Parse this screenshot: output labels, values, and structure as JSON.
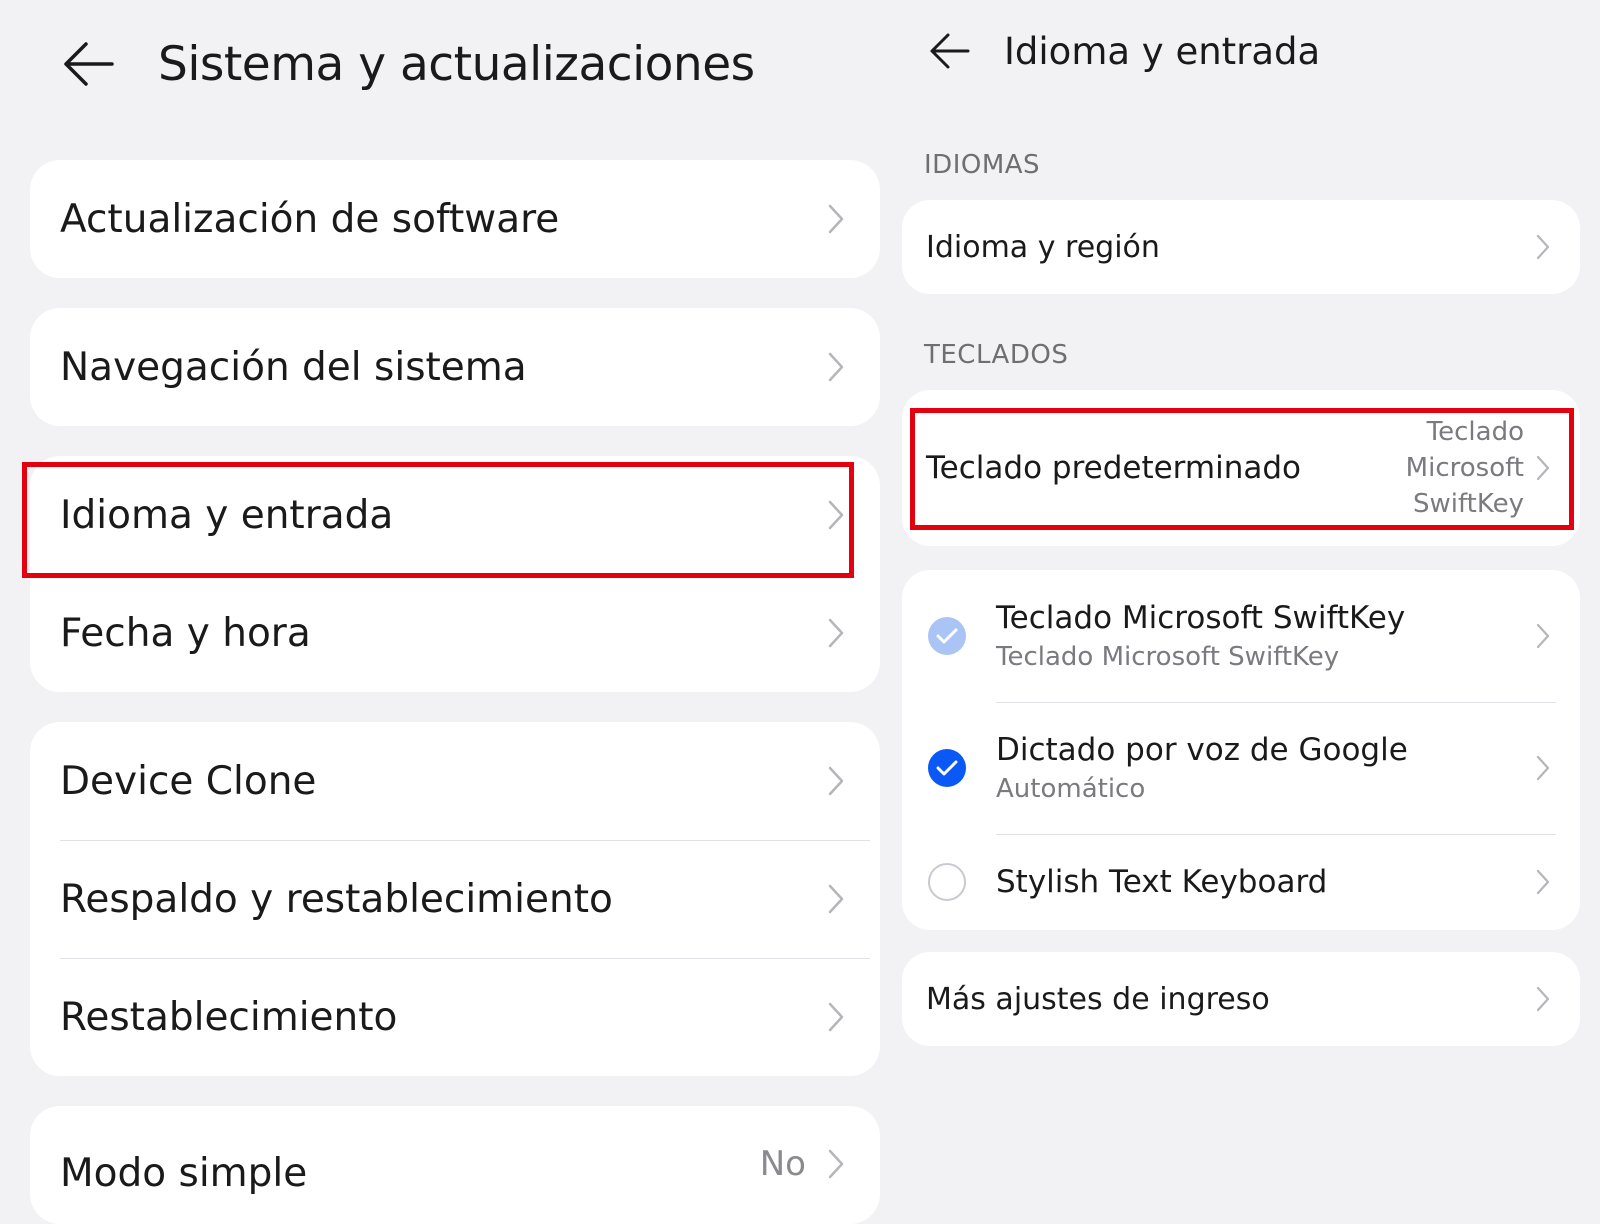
{
  "left": {
    "title": "Sistema y actualizaciones",
    "groups": [
      [
        {
          "label": "Actualización de software"
        }
      ],
      [
        {
          "label": "Navegación del sistema"
        }
      ],
      [
        {
          "label": "Idioma y entrada"
        },
        {
          "label": "Fecha y hora"
        }
      ],
      [
        {
          "label": "Device Clone"
        },
        {
          "label": "Respaldo y restablecimiento"
        },
        {
          "label": "Restablecimiento"
        }
      ],
      [
        {
          "label": "Modo simple",
          "value": "No"
        }
      ]
    ]
  },
  "right": {
    "title": "Idioma y entrada",
    "section_languages": "IDIOMAS",
    "language_region": "Idioma y región",
    "section_keyboards": "TECLADOS",
    "default_keyboard": {
      "label": "Teclado predeterminado",
      "value_lines": [
        "Teclado",
        "Microsoft",
        "SwiftKey"
      ]
    },
    "keyboards": [
      {
        "title": "Teclado Microsoft SwiftKey",
        "subtitle": "Teclado Microsoft SwiftKey",
        "state": "checked-disabled"
      },
      {
        "title": "Dictado por voz de Google",
        "subtitle": "Automático",
        "state": "checked"
      },
      {
        "title": "Stylish Text Keyboard",
        "subtitle": "",
        "state": "unchecked"
      }
    ],
    "more_settings": "Más ajustes de ingreso"
  },
  "colors": {
    "background": "#f2f2f5",
    "card": "#ffffff",
    "accent_blue": "#0a59f7",
    "disabled_blue": "#a9c4f5",
    "highlight_red": "#e3000f",
    "secondary_text": "#7a7a7f"
  },
  "icons": [
    "back-arrow-icon",
    "chevron-right-icon",
    "checkmark-icon"
  ]
}
